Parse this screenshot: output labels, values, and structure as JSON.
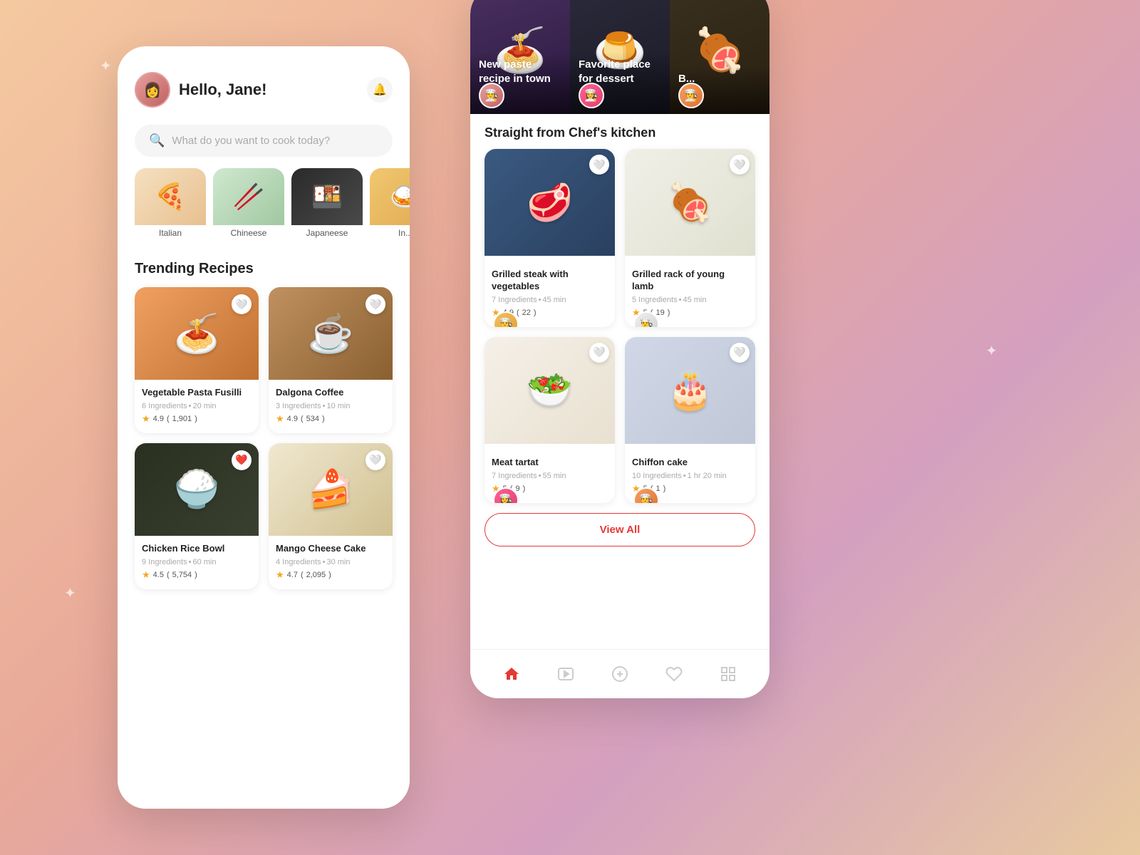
{
  "background": "gradient peach-pink",
  "left_phone": {
    "greeting": "Hello, Jane!",
    "search_placeholder": "What do you want to cook today?",
    "categories": [
      {
        "label": "Italian",
        "emoji": "🍕"
      },
      {
        "label": "Chineese",
        "emoji": "🥢"
      },
      {
        "label": "Japaneese",
        "emoji": "🍣"
      },
      {
        "label": "In...",
        "emoji": "🍛"
      }
    ],
    "trending_title": "Trending Recipes",
    "recipes": [
      {
        "name": "Vegetable Pasta Fusilli",
        "ingredients": "6 Ingredients",
        "time": "20 min",
        "rating": "4.9",
        "reviews": "1,901",
        "favorited": false,
        "emoji": "🍝"
      },
      {
        "name": "Dalgona Coffee",
        "ingredients": "3 Ingredients",
        "time": "10 min",
        "rating": "4.9",
        "reviews": "534",
        "favorited": false,
        "emoji": "☕"
      },
      {
        "name": "Chicken Rice Bowl",
        "ingredients": "9 Ingredients",
        "time": "60 min",
        "rating": "4.5",
        "reviews": "5,754",
        "favorited": true,
        "emoji": "🍚"
      },
      {
        "name": "Mango Cheese Cake",
        "ingredients": "4 Ingredients",
        "time": "30 min",
        "rating": "4.7",
        "reviews": "2,095",
        "favorited": false,
        "emoji": "🍰"
      }
    ]
  },
  "right_phone": {
    "stories": [
      {
        "title": "New paste recipe in town",
        "emoji": "🍝"
      },
      {
        "title": "Favorite place for dessert",
        "emoji": "🍮"
      },
      {
        "title": "B...",
        "emoji": "🍖"
      }
    ],
    "chefs_section_title": "Straight from Chef's kitchen",
    "chef_recipes": [
      {
        "name": "Grilled steak with vegetables",
        "ingredients": "7 Ingredients",
        "time": "45 min",
        "rating": "4.9",
        "reviews": "22",
        "favorited": false,
        "emoji": "🥩"
      },
      {
        "name": "Grilled rack of young lamb",
        "ingredients": "5 Ingredients",
        "time": "45 min",
        "rating": "5",
        "reviews": "19",
        "favorited": false,
        "emoji": "🍖"
      },
      {
        "name": "Meat tartat",
        "ingredients": "7 Ingredients",
        "time": "55 min",
        "rating": "5",
        "reviews": "9",
        "favorited": false,
        "emoji": "🥗"
      },
      {
        "name": "Chiffon cake",
        "ingredients": "10 Ingredients",
        "time": "1 hr 20 min",
        "rating": "5",
        "reviews": "1",
        "favorited": false,
        "emoji": "🎂"
      }
    ],
    "view_all_label": "View All",
    "nav_items": [
      "home",
      "video",
      "add",
      "heart",
      "grid"
    ]
  }
}
